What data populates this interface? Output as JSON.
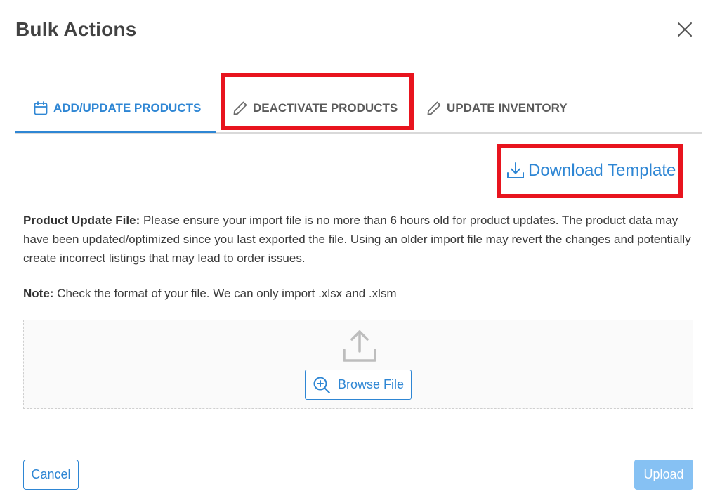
{
  "dialog": {
    "title": "Bulk Actions",
    "close_icon": "close-icon"
  },
  "tabs": [
    {
      "label": "ADD/UPDATE PRODUCTS",
      "icon": "calendar-icon",
      "active": true
    },
    {
      "label": "DEACTIVATE PRODUCTS",
      "icon": "pencil-icon",
      "active": false
    },
    {
      "label": "UPDATE INVENTORY",
      "icon": "pencil-icon",
      "active": false
    }
  ],
  "download_template": {
    "label": "Download Template",
    "icon": "download-icon"
  },
  "instructions": {
    "product_update_heading": "Product Update File:",
    "product_update_text": " Please ensure your import file is no more than 6 hours old for product updates. The product data may have been updated/optimized since you last exported the file. Using an older import file may revert the changes and potentially create incorrect listings that may lead to order issues.",
    "note_heading": "Note:",
    "note_text": " Check the format of your file. We can only import .xlsx and .xlsm"
  },
  "dropzone": {
    "upload_icon": "upload-icon",
    "browse_label": "Browse File",
    "browse_icon": "zoom-in-icon"
  },
  "footer": {
    "cancel_label": "Cancel",
    "upload_label": "Upload"
  },
  "colors": {
    "accent": "#2e86d4",
    "highlight": "#e8141e",
    "upload_disabled": "#86c1f3"
  }
}
